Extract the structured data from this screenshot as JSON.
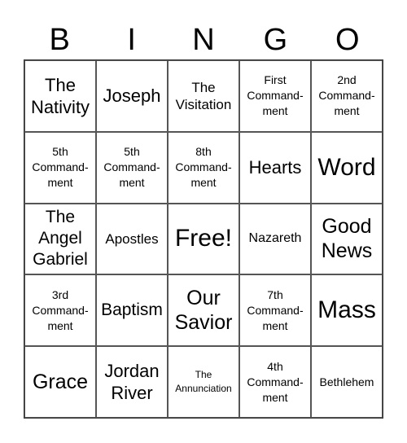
{
  "header": {
    "letters": [
      "B",
      "I",
      "N",
      "G",
      "O"
    ]
  },
  "board": {
    "rows": [
      [
        "The Nativity",
        "Joseph",
        "The Visitation",
        "First Command-ment",
        "2nd Command-ment"
      ],
      [
        "5th Command-ment",
        "5th Command-ment",
        "8th Command-ment",
        "Hearts",
        "Word"
      ],
      [
        "The Angel Gabriel",
        "Apostles",
        "Free!",
        "Nazareth",
        "Good News"
      ],
      [
        "3rd Command-ment",
        "Baptism",
        "Our Savior",
        "7th Command-ment",
        "Mass"
      ],
      [
        "Grace",
        "Jordan River",
        "The Annunciation",
        "4th Command-ment",
        "Bethlehem"
      ]
    ]
  },
  "display": {
    "rows": [
      [
        [
          "The",
          "Nativity"
        ],
        [
          "Joseph"
        ],
        [
          "The",
          "Visitation"
        ],
        [
          "First",
          "Command-",
          "ment"
        ],
        [
          "2nd",
          "Command-",
          "ment"
        ]
      ],
      [
        [
          "5th",
          "Command-",
          "ment"
        ],
        [
          "5th",
          "Command-",
          "ment"
        ],
        [
          "8th",
          "Command-",
          "ment"
        ],
        [
          "Hearts"
        ],
        [
          "Word"
        ]
      ],
      [
        [
          "The",
          "Angel",
          "Gabriel"
        ],
        [
          "Apostles"
        ],
        [
          "Free!"
        ],
        [
          "Nazareth"
        ],
        [
          "Good",
          "News"
        ]
      ],
      [
        [
          "3rd",
          "Command-",
          "ment"
        ],
        [
          "Baptism"
        ],
        [
          "Our",
          "Savior"
        ],
        [
          "7th",
          "Command-",
          "ment"
        ],
        [
          "Mass"
        ]
      ],
      [
        [
          "Grace"
        ],
        [
          "Jordan",
          "River"
        ],
        [
          "The",
          "Annunciation"
        ],
        [
          "4th",
          "Command-",
          "ment"
        ],
        [
          "Bethlehem"
        ]
      ]
    ]
  }
}
